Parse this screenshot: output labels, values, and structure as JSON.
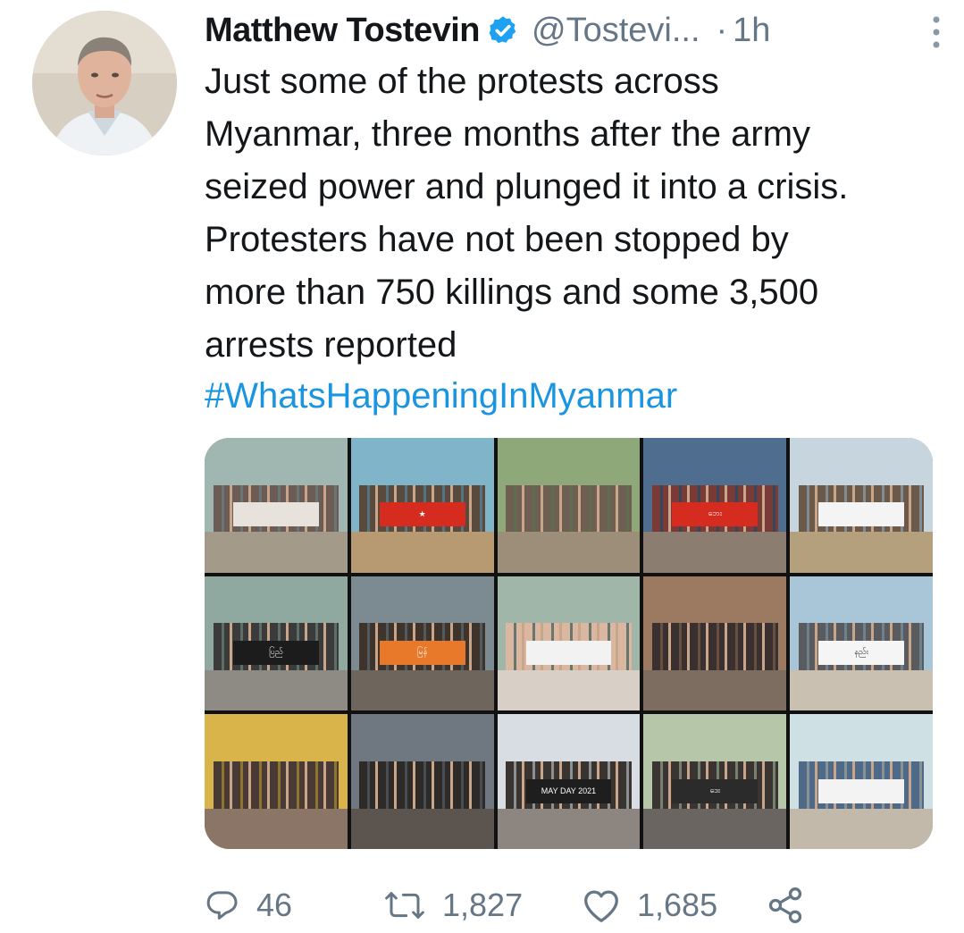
{
  "author": {
    "name": "Matthew Tostevin",
    "handle": "@Tostevi...",
    "separator": "·",
    "time": "1h",
    "verified": true,
    "avatar_icon": "avatar-photo"
  },
  "tweet": {
    "text": "Just some of the protests across\nMyanmar, three months after the army\nseized power and plunged it into a crisis.\nProtesters have not been stopped by\nmore than 750 killings and some 3,500\narrests reported",
    "hashtag": "#WhatsHappeningInMyanmar"
  },
  "media": {
    "tiles": [
      {
        "sky": "#9fb7b0",
        "crowd": "#6d5b55",
        "ground": "#a39a8a",
        "banner": "#e8e2dc",
        "banner_text": ""
      },
      {
        "sky": "#7fb4c9",
        "crowd": "#5a4a3e",
        "ground": "#b89a72",
        "banner": "#d62b1f",
        "banner_text": "★"
      },
      {
        "sky": "#8fa87a",
        "crowd": "#6e5f52",
        "ground": "#9c8e78",
        "banner": "",
        "banner_text": ""
      },
      {
        "sky": "#4f6d8e",
        "crowd": "#7a3a35",
        "ground": "#8b7e70",
        "banner": "#d62b1f",
        "banner_text": "ဘေး"
      },
      {
        "sky": "#c7d6de",
        "crowd": "#6b5a4a",
        "ground": "#b5a07e",
        "banner": "#f4f4f4",
        "banner_text": ""
      },
      {
        "sky": "#8fa9a0",
        "crowd": "#3b3b3b",
        "ground": "#8e8a84",
        "banner": "#1c1c1c",
        "banner_text": "ပြည်"
      },
      {
        "sky": "#7c8a92",
        "crowd": "#3e342c",
        "ground": "#6e655c",
        "banner": "#e8792b",
        "banner_text": "မြန်"
      },
      {
        "sky": "#9fb6a8",
        "crowd": "#d9b7a0",
        "ground": "#d8d0c6",
        "banner": "#f2f2f2",
        "banner_text": ""
      },
      {
        "sky": "#9c7a62",
        "crowd": "#3b3030",
        "ground": "#7d6c60",
        "banner": "",
        "banner_text": ""
      },
      {
        "sky": "#a9c6d8",
        "crowd": "#5a5b5e",
        "ground": "#c9c0b2",
        "banner": "#f5f5f5",
        "banner_text": "နည်း"
      },
      {
        "sky": "#d8b44a",
        "crowd": "#4a3a36",
        "ground": "#8a7566",
        "banner": "",
        "banner_text": ""
      },
      {
        "sky": "#6f7780",
        "crowd": "#2d2a28",
        "ground": "#5c554f",
        "banner": "",
        "banner_text": ""
      },
      {
        "sky": "#d7dde2",
        "crowd": "#3a3431",
        "ground": "#8d8680",
        "banner": "#1e1e1e",
        "banner_text": "MAY DAY 2021"
      },
      {
        "sky": "#b5c7a8",
        "crowd": "#3a3532",
        "ground": "#6b6561",
        "banner": "#2b2b2b",
        "banner_text": "ဒေး"
      },
      {
        "sky": "#cfe0e4",
        "crowd": "#4f6a88",
        "ground": "#c3b9ab",
        "banner": "#f3f3f3",
        "banner_text": ""
      }
    ]
  },
  "actions": {
    "replies": "46",
    "retweets": "1,827",
    "likes": "1,685",
    "reply_icon": "reply-icon",
    "retweet_icon": "retweet-icon",
    "like_icon": "heart-icon",
    "share_icon": "share-icon"
  },
  "colors": {
    "link": "#1b95e0",
    "verified": "#1da1f2",
    "muted": "#657786"
  }
}
